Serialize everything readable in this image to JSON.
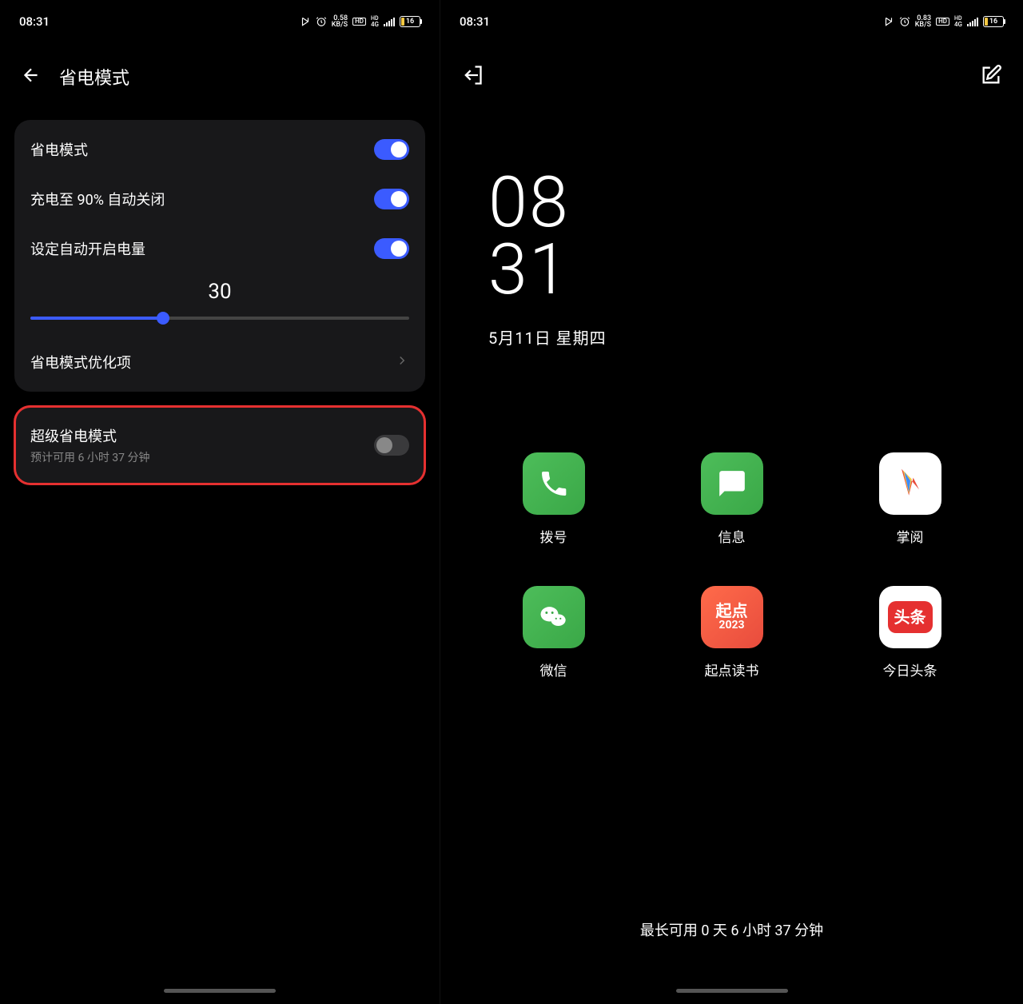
{
  "status_bar": {
    "time": "08:31",
    "kbs_left": "0.58",
    "kbs_left_unit": "KB/S",
    "kbs_right": "0.83",
    "kbs_right_unit": "KB/S",
    "hd": "HD",
    "signal_label": "4G",
    "battery_percent": "16"
  },
  "header": {
    "title": "省电模式"
  },
  "settings": {
    "power_saving_label": "省电模式",
    "auto_off_90_label": "充电至 90% 自动关闭",
    "auto_on_level_label": "设定自动开启电量",
    "slider_value": "30",
    "optimizations_label": "省电模式优化项"
  },
  "ultra": {
    "title": "超级省电模式",
    "subtitle": "预计可用 6 小时 37 分钟"
  },
  "clock": {
    "hour": "08",
    "minute": "31",
    "date": "5月11日  星期四"
  },
  "apps": {
    "phone": "拨号",
    "message": "信息",
    "reader": "掌阅",
    "wechat": "微信",
    "qidian": "起点读书",
    "qidian_top": "起点",
    "qidian_bottom": "2023",
    "toutiao": "今日头条",
    "toutiao_text": "头条"
  },
  "footer": {
    "text": "最长可用 0 天 6 小时 37 分钟"
  }
}
